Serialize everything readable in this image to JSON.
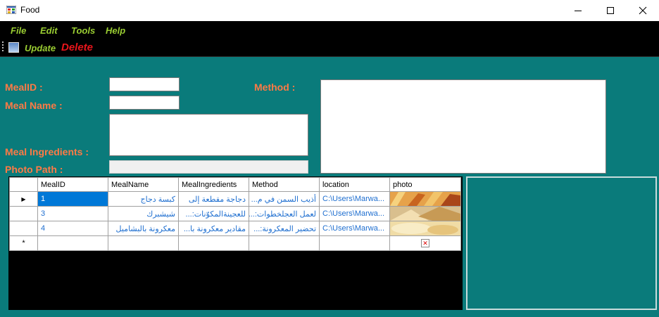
{
  "window": {
    "title": "Food"
  },
  "menu": [
    "File",
    "Edit",
    "Tools",
    "Help"
  ],
  "toolbar": {
    "update": "Update",
    "delete": "Delete"
  },
  "form": {
    "meal_id_label": "MealID :",
    "meal_name_label": "Meal Name :",
    "method_label": "Method :",
    "ingredients_label": "Meal Ingredients :",
    "photo_path_label": "Photo Path :",
    "meal_id_value": "",
    "meal_name_value": "",
    "method_value": "",
    "ingredients_value": "",
    "photo_path_value": ""
  },
  "grid": {
    "columns": [
      "MealID",
      "MealName",
      "MealIngredients",
      "Method",
      "location",
      "photo"
    ],
    "rows": [
      {
        "id": "1",
        "name": "كبسة دجاج",
        "ingredients": "دجاجة مقطعة إلى",
        "method": "أذيب السمن في م...",
        "location": "C:\\Users\\Marwa...",
        "selected": true
      },
      {
        "id": "3",
        "name": "شيشبرك",
        "ingredients": "للعجينةالمكوّنات:...",
        "method": "لعمل العجلخطوات:...",
        "location": "C:\\Users\\Marwa...",
        "selected": false
      },
      {
        "id": "4",
        "name": "معكرونة بالبشاميل",
        "ingredients": "مقادير معكرونة با...",
        "method": "تحضير المعكرونة:...",
        "location": "C:\\Users\\Marwa...",
        "selected": false
      }
    ],
    "new_row_marker": "*",
    "current_row_marker": "▶"
  },
  "colors": {
    "background": "#0a7b7b",
    "menu_text": "#9acd32",
    "delete_text": "#e8151b",
    "label_text": "#ff7a45",
    "selection": "#0078d7"
  }
}
